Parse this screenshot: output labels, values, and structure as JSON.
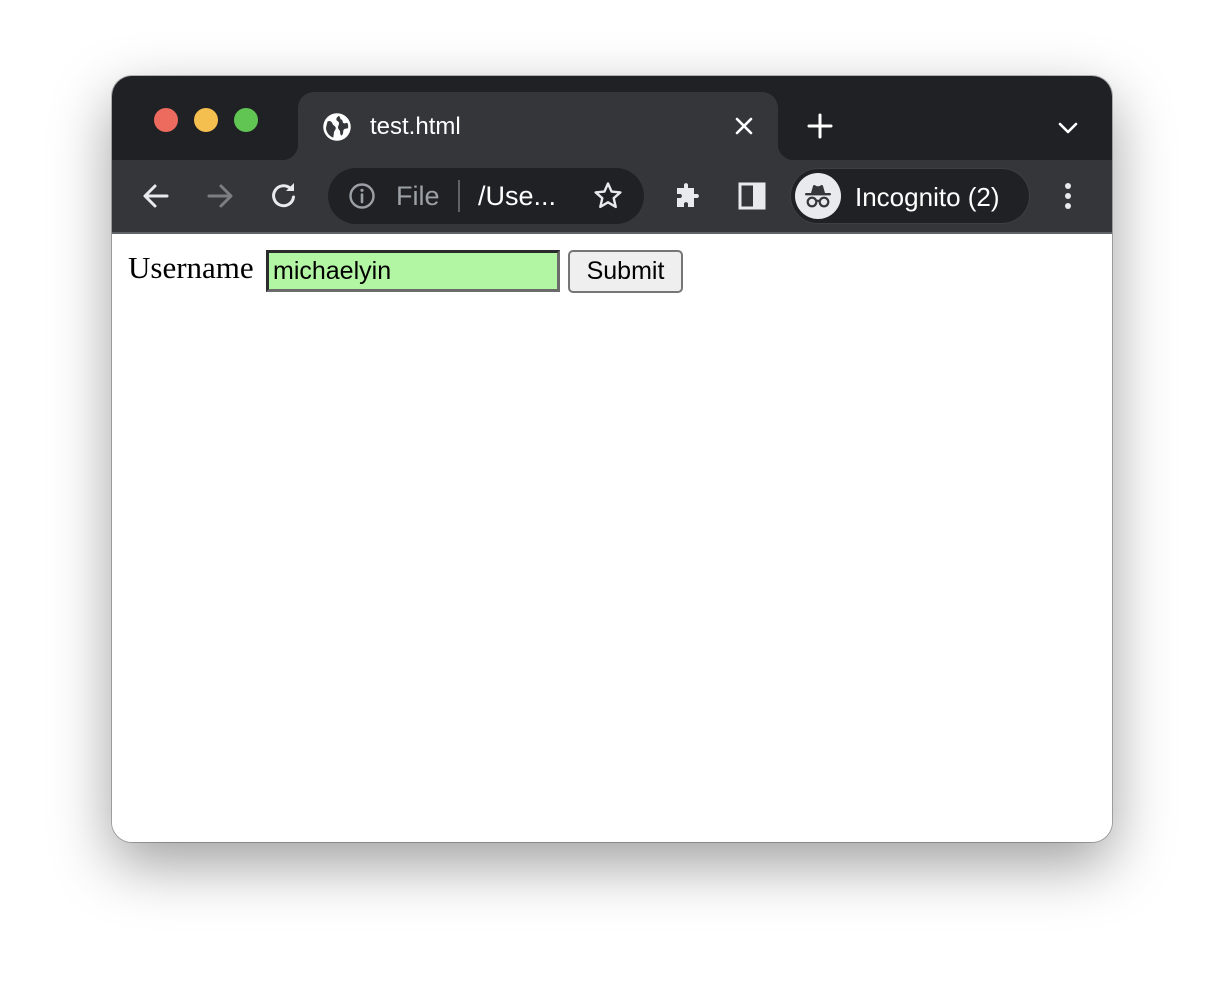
{
  "window": {
    "traffic_lights": {
      "close_color": "#ed6a5e",
      "minimize_color": "#f4bf4f",
      "maximize_color": "#61c554"
    }
  },
  "tab": {
    "title": "test.html",
    "favicon": "globe-icon"
  },
  "toolbar": {
    "scheme_label": "File",
    "url": "/Use...",
    "profile_label": "Incognito (2)"
  },
  "page": {
    "username_label": "Username",
    "username_value": "michaelyin",
    "submit_label": "Submit",
    "input_background": "#b2f5a3"
  },
  "colors": {
    "titlebar": "#202124",
    "toolbar": "#35363a"
  }
}
